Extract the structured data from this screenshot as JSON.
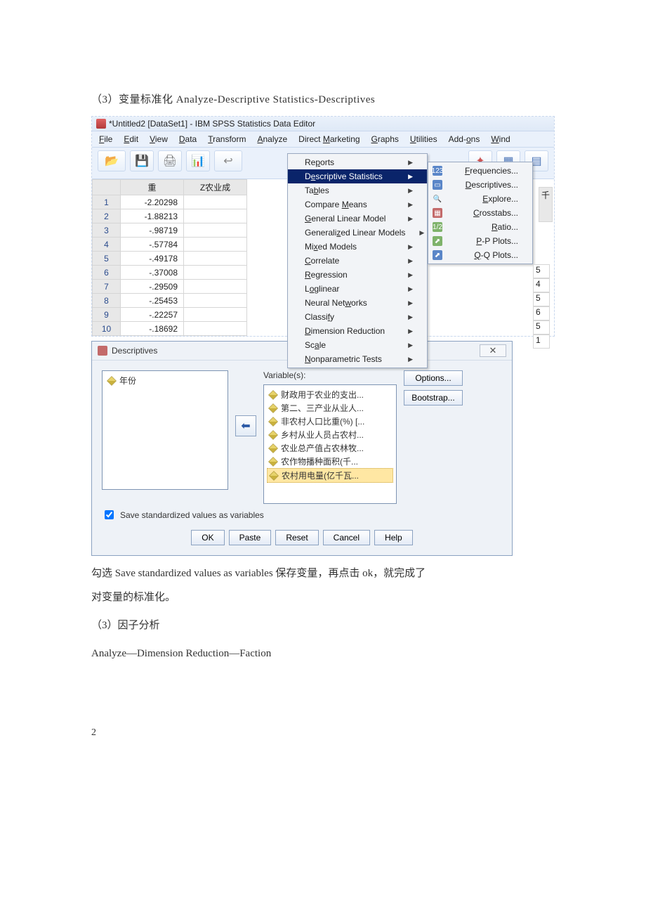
{
  "doc": {
    "heading": "（3）变量标准化 Analyze-Descriptive Statistics-Descriptives",
    "after_text_1": "勾选 Save standardized values as variables 保存变量，再点击 ok，就完成了",
    "after_text_2": "对变量的标准化。",
    "section2_title": "（3）因子分析",
    "section2_path": "Analyze—Dimension Reduction—Faction",
    "page_num": "2"
  },
  "spss": {
    "title": "*Untitled2 [DataSet1] - IBM SPSS Statistics Data Editor",
    "menus": [
      "File",
      "Edit",
      "View",
      "Data",
      "Transform",
      "Analyze",
      "Direct Marketing",
      "Graphs",
      "Utilities",
      "Add-ons",
      "Wind"
    ],
    "col_headers": [
      "",
      "重",
      "Z农业成"
    ],
    "rows": [
      {
        "n": "1",
        "v": "-2.20298"
      },
      {
        "n": "2",
        "v": "-1.88213"
      },
      {
        "n": "3",
        "v": "-.98719"
      },
      {
        "n": "4",
        "v": "-.57784"
      },
      {
        "n": "5",
        "v": "-.49178"
      },
      {
        "n": "6",
        "v": "-.37008"
      },
      {
        "n": "7",
        "v": "-.29509"
      },
      {
        "n": "8",
        "v": "-.25453"
      },
      {
        "n": "9",
        "v": "-.22257"
      },
      {
        "n": "10",
        "v": "-.18692"
      }
    ],
    "side_col": [
      "",
      "",
      "",
      "",
      "",
      "5",
      "4",
      "5",
      "6",
      "5",
      "1"
    ],
    "analyze_menu": [
      "Reports",
      "Descriptive Statistics",
      "Tables",
      "Compare Means",
      "General Linear Model",
      "Generalized Linear Models",
      "Mixed Models",
      "Correlate",
      "Regression",
      "Loglinear",
      "Neural Networks",
      "Classify",
      "Dimension Reduction",
      "Scale",
      "Nonparametric Tests"
    ],
    "analyze_selected": "Descriptive Statistics",
    "desc_submenu": [
      "Frequencies...",
      "Descriptives...",
      "Explore...",
      "Crosstabs...",
      "Ratio...",
      "P-P Plots...",
      "Q-Q Plots..."
    ],
    "extra_col_header": "千"
  },
  "dialog": {
    "title": "Descriptives",
    "left_list": [
      "年份"
    ],
    "variable_label": "Variable(s):",
    "right_list": [
      "财政用于农业的支出...",
      "第二、三产业从业人...",
      "非农村人口比重(%) [...",
      "乡村从业人员占农村...",
      "农业总产值占农林牧...",
      "农作物播种面积(千...",
      "农村用电量(亿千瓦..."
    ],
    "right_selected_index": 6,
    "options_btn": "Options...",
    "bootstrap_btn": "Bootstrap...",
    "check_label": "Save standardized values as variables",
    "buttons": [
      "OK",
      "Paste",
      "Reset",
      "Cancel",
      "Help"
    ]
  }
}
